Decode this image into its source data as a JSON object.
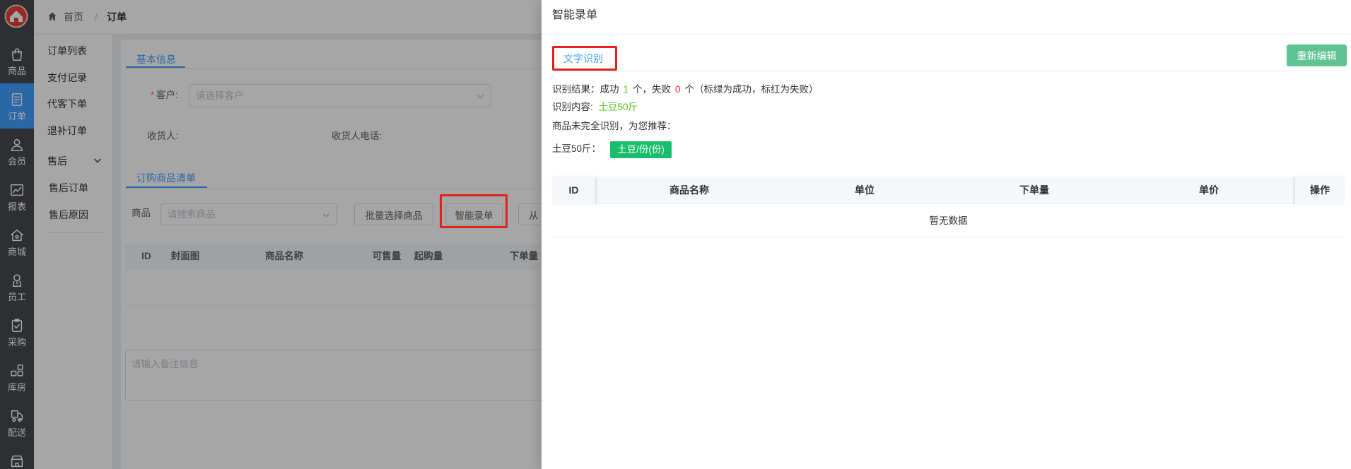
{
  "colors": {
    "accent": "#409eff",
    "success_text": "#52c41a",
    "danger_text": "#f5222d",
    "tag_bg": "#19be6b",
    "reedit_bg": "#5ec391",
    "sidebar_bg": "#47494f",
    "highlight_border": "#e5201b",
    "required_mark": "#f56c6c"
  },
  "sidebar": {
    "logo": "brand-logo",
    "items": [
      {
        "label": "商品",
        "icon": "shopping-bag-icon",
        "active": false
      },
      {
        "label": "订单",
        "icon": "document-icon",
        "active": true
      },
      {
        "label": "会员",
        "icon": "user-icon",
        "active": false
      },
      {
        "label": "报表",
        "icon": "chart-icon",
        "active": false
      },
      {
        "label": "商城",
        "icon": "home-icon",
        "active": false
      },
      {
        "label": "员工",
        "icon": "staff-icon",
        "active": false
      },
      {
        "label": "采购",
        "icon": "clipboard-icon",
        "active": false
      },
      {
        "label": "库房",
        "icon": "warehouse-icon",
        "active": false
      },
      {
        "label": "配送",
        "icon": "delivery-icon",
        "active": false
      },
      {
        "icon": "store-icon",
        "active": false
      }
    ]
  },
  "breadcrumb": {
    "home": "首页",
    "separator": "/",
    "current": "订单"
  },
  "submenu": {
    "items": [
      "订单列表",
      "支付记录",
      "代客下单",
      "退补订单"
    ],
    "group": {
      "label": "售后",
      "expanded": true,
      "children": [
        "售后订单",
        "售后原因"
      ]
    }
  },
  "order_form": {
    "tab_basic": "基本信息",
    "customer": {
      "required_mark": "*",
      "label": "客户:",
      "placeholder": "请选择客户"
    },
    "receiver_label": "收货人:",
    "receiver_phone_label": "收货人电话:",
    "tab_goods": "订购商品清单",
    "goods": {
      "label": "商品",
      "placeholder": "请搜索商品"
    },
    "buttons": {
      "batch_select": "批量选择商品",
      "smart_entry": "智能录单",
      "import_partial": "从"
    },
    "table_headers": [
      "ID",
      "封面图",
      "商品名称",
      "可售量",
      "起购量",
      "下单量"
    ],
    "remark_placeholder": "请输入备注信息"
  },
  "drawer": {
    "title": "智能录单",
    "tabs": [
      {
        "label": "文字识别",
        "active": true
      }
    ],
    "reedit_button": "重新编辑",
    "result": {
      "prefix": "识别结果：成功",
      "success_count": 1,
      "mid": "个，失败",
      "fail_count": 0,
      "suffix": "个（标绿为成功，标红为失败）"
    },
    "content": {
      "label": "识别内容:",
      "value": "土豆50斤"
    },
    "recommend_text": "商品未完全识别，为您推荐：",
    "suggestions": [
      {
        "source": "土豆50斤：",
        "options": [
          "土豆/份(份)"
        ]
      }
    ],
    "table": {
      "headers": [
        "ID",
        "商品名称",
        "单位",
        "下单量",
        "单价",
        "操作"
      ],
      "empty_text": "暂无数据"
    }
  }
}
